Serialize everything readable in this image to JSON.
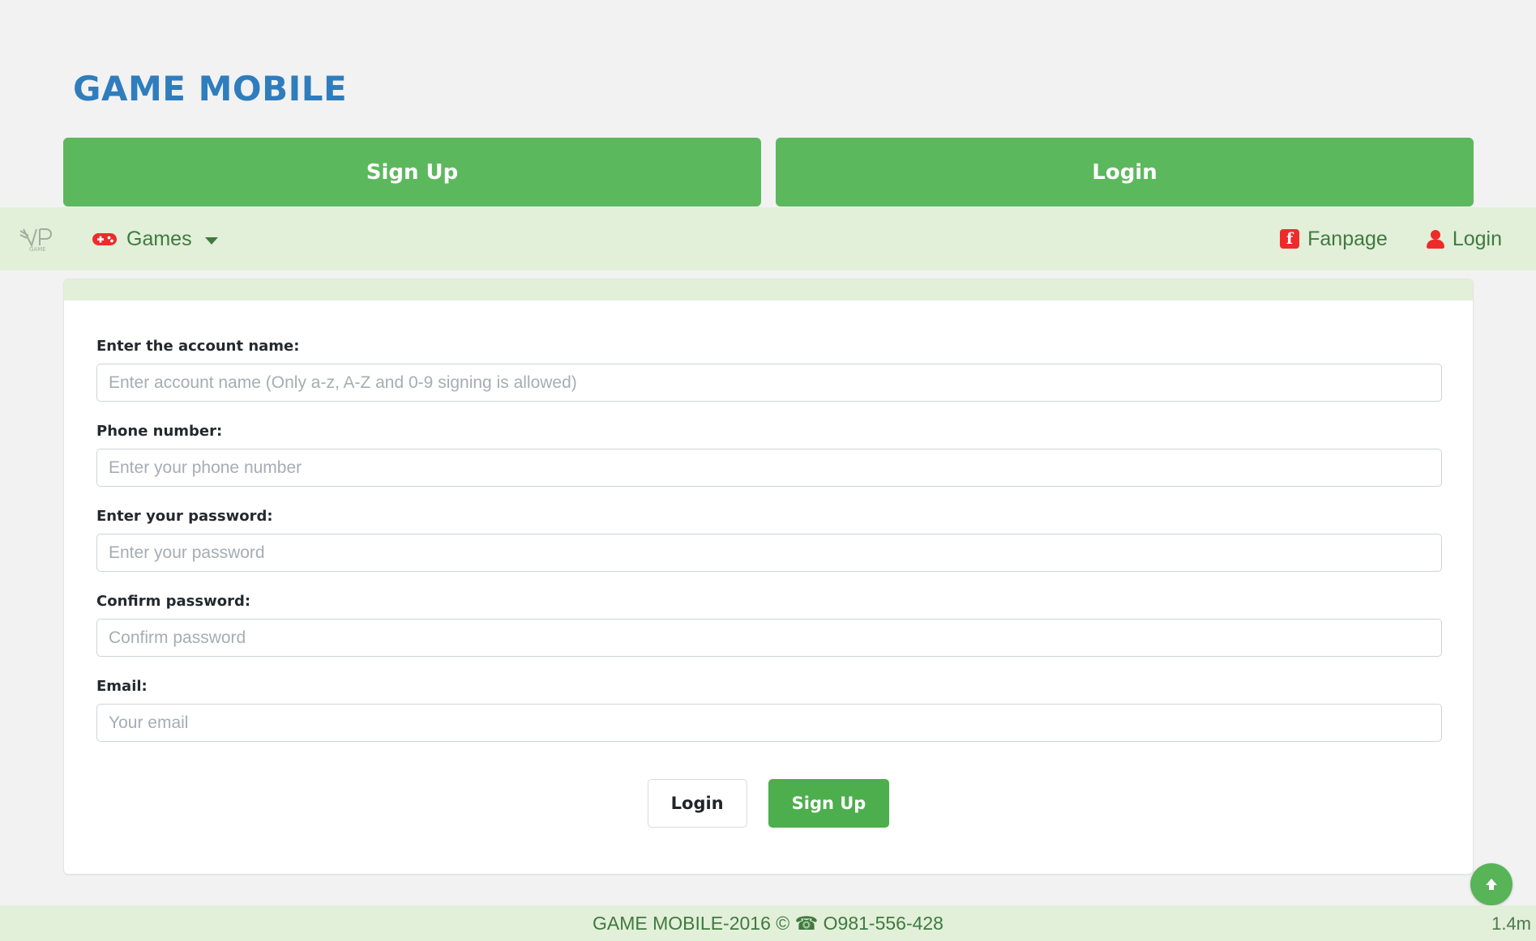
{
  "brand": {
    "title": "GAME MOBILE",
    "color": "#2f7dbd"
  },
  "auth_buttons": [
    {
      "label": "Sign Up",
      "name": "signup"
    },
    {
      "label": "Login",
      "name": "login"
    }
  ],
  "navbar": {
    "logo_alt": "VIP GAME",
    "menu": {
      "label": "Games",
      "icon": "gamepad-icon",
      "caret": "chevron-down-icon"
    },
    "right_items": [
      {
        "label": "Fanpage",
        "icon": "facebook-icon",
        "glyph": "f"
      },
      {
        "label": "Login",
        "icon": "user-icon"
      }
    ],
    "bg_color": "#e2efd9",
    "text_color": "#3f7a3f",
    "icon_color": "#ee2b2b"
  },
  "form": {
    "fields": [
      {
        "label": "Enter the account name:",
        "placeholder": "Enter account name (Only a-z, A-Z and 0-9 signing is allowed)",
        "value": "",
        "type": "text",
        "name": "account-name"
      },
      {
        "label": "Phone number:",
        "placeholder": "Enter your phone number",
        "value": "",
        "type": "text",
        "name": "phone-number"
      },
      {
        "label": "Enter your password:",
        "placeholder": "Enter your password",
        "value": "",
        "type": "text",
        "name": "password"
      },
      {
        "label": "Confirm password:",
        "placeholder": "Confirm password",
        "value": "",
        "type": "text",
        "name": "confirm-password"
      },
      {
        "label": "Email:",
        "placeholder": "Your email",
        "value": "",
        "type": "text",
        "name": "email"
      }
    ],
    "actions": [
      {
        "label": "Login",
        "style": "light",
        "name": "login"
      },
      {
        "label": "Sign Up",
        "style": "green",
        "name": "signup"
      }
    ]
  },
  "footer": {
    "text": "GAME MOBILE-2016 © ☎ O981-556-428"
  },
  "scroll_top": {
    "icon": "arrow-up-icon"
  },
  "corner_note": {
    "text": "1.4m"
  },
  "colors": {
    "accent_green": "#5cb85c",
    "page_bg": "#f2f2f3"
  }
}
